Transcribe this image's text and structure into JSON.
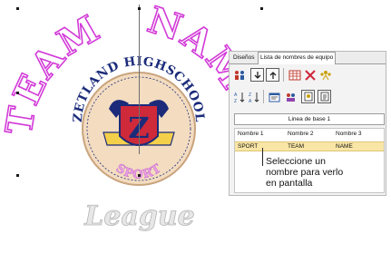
{
  "artwork": {
    "arc_text_left": "TEAM",
    "arc_text_right": "NAME",
    "badge_top_text": "ZETLAND HIGHSCHOOL",
    "badge_letter": "Z",
    "badge_bottom_text": "SPORT",
    "league_text": "League",
    "colors": {
      "outline": "#d23ad8",
      "badge_fill": "#f3dcc0",
      "badge_text": "#1b2b7a",
      "sport_pink": "#eaa0e0"
    }
  },
  "panel": {
    "tabs": [
      {
        "label": "Diseños"
      },
      {
        "label": "Lista de nombres de equipo"
      }
    ],
    "toolbar1": [
      {
        "icon": "team-people-icon"
      },
      {
        "icon": "arrow-down-icon"
      },
      {
        "icon": "arrow-up-icon"
      },
      {
        "icon": "grid-table-icon"
      },
      {
        "icon": "delete-x-icon"
      },
      {
        "icon": "people-group-icon"
      }
    ],
    "toolbar2": [
      {
        "icon": "sort-ascending-icon"
      },
      {
        "icon": "sort-descending-icon"
      },
      {
        "icon": "properties-icon"
      },
      {
        "icon": "team-settings-icon"
      },
      {
        "icon": "import-icon"
      },
      {
        "icon": "export-icon"
      }
    ],
    "baseline_label": "Linea de base 1",
    "columns": [
      "Nombre 1",
      "Nombre 2",
      "Nombre 3"
    ],
    "rows": [
      [
        "SPORT",
        "TEAM",
        "NAME"
      ]
    ]
  },
  "tooltip": {
    "line1": "Seleccione un",
    "line2": "nombre para verlo",
    "line3": "en pantalla"
  }
}
